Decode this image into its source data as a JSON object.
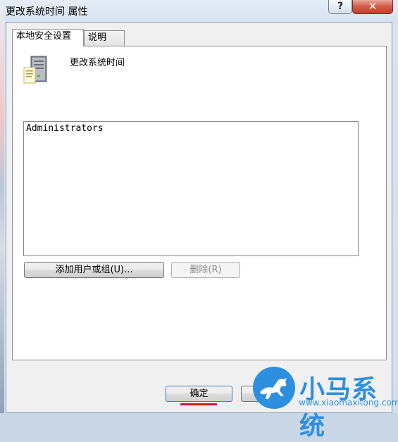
{
  "window": {
    "title": "更改系统时间 属性",
    "help_label": "?",
    "close_label": "✕"
  },
  "tabs": [
    {
      "label": "本地安全设置",
      "active": true
    },
    {
      "label": "说明",
      "active": false
    }
  ],
  "policy": {
    "icon": "server-policy-icon",
    "name": "更改系统时间"
  },
  "members": [
    "Administrators"
  ],
  "buttons": {
    "add": "添加用户或组(U)...",
    "remove": "删除(R)",
    "ok": "确定",
    "cancel": ""
  },
  "watermark": {
    "name": "小马系统",
    "url": "www.xiaomaxitong.com",
    "color": "#2c8fe0"
  }
}
